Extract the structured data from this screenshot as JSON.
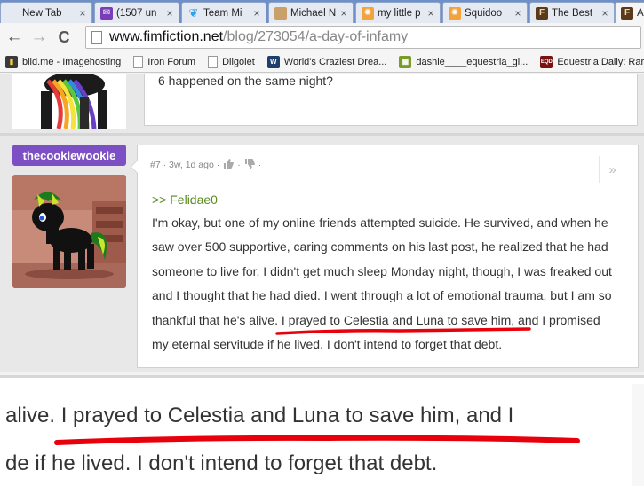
{
  "browser": {
    "tabs": [
      {
        "label": "New Tab",
        "icon": "blank-page-icon",
        "active": false
      },
      {
        "label": "(1507 un",
        "icon": "mail-icon",
        "active": false
      },
      {
        "label": "Team Mi",
        "icon": "twitter-bird-icon",
        "active": false
      },
      {
        "label": "Michael N",
        "icon": "pony-favicon",
        "active": false
      },
      {
        "label": "my little p",
        "icon": "squidoo-icon",
        "active": false
      },
      {
        "label": "Squidoo",
        "icon": "squidoo-icon",
        "active": false
      },
      {
        "label": "The Best",
        "icon": "fimfiction-icon",
        "active": false
      },
      {
        "label": "A c",
        "icon": "fimfiction-icon",
        "active": true
      }
    ],
    "close_glyph": "×",
    "back_glyph": "←",
    "forward_glyph": "→",
    "reload_glyph": "C",
    "address": {
      "host": "www.fimfiction.net",
      "path": "/blog/273054/a-day-of-infamy"
    },
    "bookmarks": [
      {
        "label": "bild.me - Imagehosting",
        "icon": "bildme-icon"
      },
      {
        "label": "Iron Forum",
        "icon": "page-icon"
      },
      {
        "label": "Diigolet",
        "icon": "page-icon"
      },
      {
        "label": "World's Craziest Drea...",
        "icon": "w-favicon"
      },
      {
        "label": "dashie____equestria_gi...",
        "icon": "image-icon"
      },
      {
        "label": "Equestria Daily: Rarit",
        "icon": "eqd-favicon"
      }
    ]
  },
  "previous_comment": {
    "text": "6 happened on the same night?"
  },
  "comment": {
    "username": "thecookiewookie",
    "meta": "#7 · 3w, 1d ago ·",
    "meta_end": "·",
    "share_glyph": "»",
    "quote": ">> Felidae0",
    "lines": [
      "I'm okay, but one of my online friends attempted suicide. He survived, and when he",
      "saw over 500 supportive, caring comments on his last post, he realized that he had",
      "someone to live for. I didn't get much sleep Monday night, though, I was freaked out",
      "and I thought that he had died. I went through a lot of emotional trauma, but I am so",
      "thankful that he's alive. I prayed to Celestia and Luna to save him, and I promised",
      "my eternal servitude if he lived. I don't intend to forget that debt."
    ],
    "highlight_color": "#e8000a"
  },
  "zoom": {
    "line1": "alive. I prayed to Celestia and Luna to save him, and I",
    "line2": "de if he lived. I don't intend to forget that debt."
  }
}
